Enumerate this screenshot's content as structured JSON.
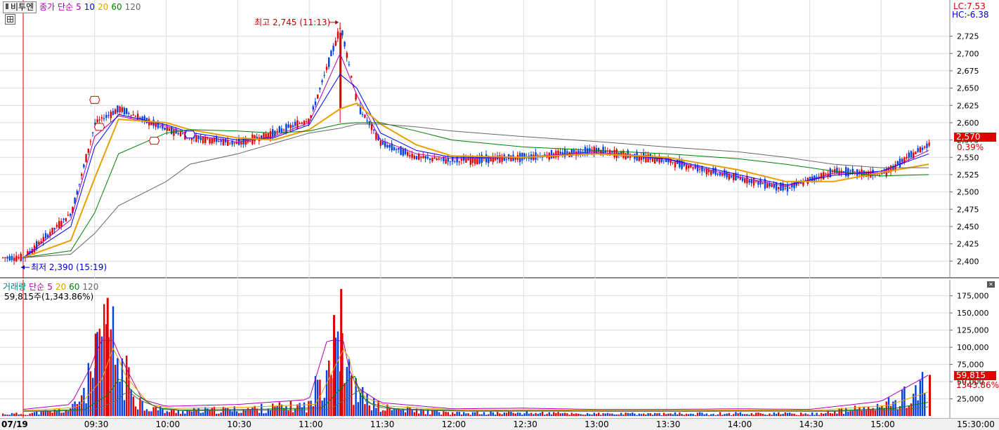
{
  "price_legend": {
    "ticker": "비투엔",
    "ma_prefix": "종가 단순",
    "periods": [
      "5",
      "10",
      "20",
      "60",
      "120"
    ],
    "colors": [
      "#b000b0",
      "#0000ff",
      "#e8a000",
      "#008000",
      "#666666"
    ]
  },
  "price_right": {
    "lc": "LC:7.53",
    "hc": "HC:-6.38",
    "current_price": "2,570",
    "change_pct": "0.39%"
  },
  "annotations": {
    "high": "최고 2,745 (11:13)",
    "low": "최저 2,390 (15:19)"
  },
  "volume_legend": {
    "title": "거래량",
    "ma_prefix": "단순",
    "periods": [
      "5",
      "20",
      "60",
      "120"
    ],
    "current_line": "59,815주(1,343.86%)",
    "current_volume": "59,815",
    "current_pct": "1343.86%"
  },
  "time_axis": {
    "date": "07/19",
    "labels": [
      "09:30",
      "10:00",
      "10:30",
      "11:00",
      "11:30",
      "12:00",
      "12:30",
      "13:00",
      "13:30",
      "14:00",
      "14:30",
      "15:00",
      "15:30:00"
    ]
  },
  "chart_data": [
    {
      "type": "candlestick",
      "title": "비투엔",
      "y_ticks": [
        "2,400",
        "2,425",
        "2,450",
        "2,475",
        "2,500",
        "2,525",
        "2,550",
        "2,575",
        "2,600",
        "2,625",
        "2,650",
        "2,675",
        "2,700",
        "2,725"
      ],
      "ylim": [
        2380,
        2755
      ],
      "high": 2745,
      "low": 2390,
      "last": 2570,
      "x_time": [
        "09:00",
        "09:20",
        "09:30",
        "09:40",
        "10:00",
        "10:10",
        "10:30",
        "10:45",
        "11:00",
        "11:13",
        "11:20",
        "11:30",
        "11:45",
        "12:00",
        "12:30",
        "13:00",
        "13:30",
        "14:00",
        "14:20",
        "14:40",
        "15:00",
        "15:20"
      ],
      "close": [
        2405,
        2470,
        2600,
        2620,
        2590,
        2580,
        2570,
        2585,
        2605,
        2740,
        2625,
        2570,
        2550,
        2545,
        2550,
        2560,
        2545,
        2520,
        2505,
        2530,
        2525,
        2570
      ],
      "ma_series": [
        {
          "name": "5",
          "values": [
            2405,
            2460,
            2580,
            2610,
            2595,
            2583,
            2572,
            2580,
            2600,
            2700,
            2640,
            2575,
            2555,
            2548,
            2550,
            2558,
            2547,
            2522,
            2508,
            2527,
            2528,
            2560
          ]
        },
        {
          "name": "10",
          "values": [
            2405,
            2450,
            2565,
            2612,
            2597,
            2586,
            2575,
            2578,
            2597,
            2670,
            2650,
            2585,
            2560,
            2550,
            2550,
            2556,
            2548,
            2525,
            2510,
            2524,
            2530,
            2555
          ]
        },
        {
          "name": "20",
          "values": [
            2405,
            2430,
            2520,
            2605,
            2600,
            2590,
            2578,
            2575,
            2590,
            2620,
            2628,
            2598,
            2568,
            2552,
            2550,
            2555,
            2550,
            2532,
            2515,
            2515,
            2528,
            2540
          ]
        },
        {
          "name": "60",
          "values": [
            2405,
            2415,
            2470,
            2555,
            2585,
            2590,
            2588,
            2585,
            2588,
            2598,
            2600,
            2600,
            2588,
            2575,
            2565,
            2560,
            2555,
            2548,
            2540,
            2530,
            2523,
            2525
          ]
        },
        {
          "name": "120",
          "values": [
            2405,
            2410,
            2440,
            2480,
            2515,
            2540,
            2555,
            2570,
            2585,
            2592,
            2598,
            2598,
            2594,
            2588,
            2580,
            2573,
            2565,
            2558,
            2550,
            2540,
            2535,
            2535
          ]
        }
      ]
    },
    {
      "type": "bar",
      "title": "거래량",
      "y_ticks": [
        "25,000",
        "50,000",
        "75,000",
        "100,000",
        "125,000",
        "150,000",
        "175,000"
      ],
      "ylim": [
        0,
        190000
      ],
      "x_time": [
        "09:00",
        "09:20",
        "09:30",
        "09:35",
        "09:40",
        "09:50",
        "10:00",
        "10:30",
        "11:00",
        "11:10",
        "11:13",
        "11:15",
        "11:20",
        "11:30",
        "12:00",
        "12:30",
        "13:00",
        "13:30",
        "14:00",
        "14:30",
        "15:00",
        "15:20"
      ],
      "values": [
        4000,
        12000,
        85000,
        172000,
        95000,
        20000,
        9000,
        12000,
        20000,
        147000,
        185000,
        85000,
        40000,
        15000,
        5000,
        6000,
        4000,
        4000,
        5000,
        4000,
        17000,
        59815
      ]
    }
  ]
}
